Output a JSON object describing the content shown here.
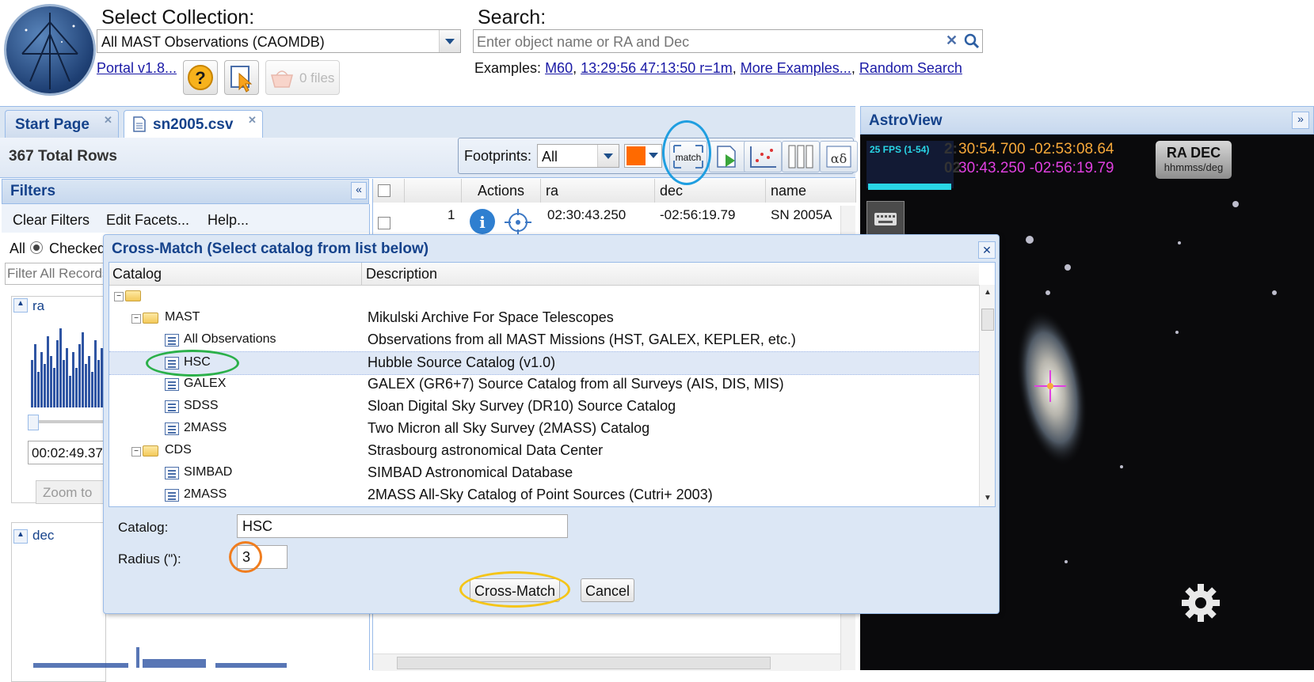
{
  "header": {
    "select_collection_label": "Select Collection:",
    "collection_value": "All MAST Observations (CAOMDB)",
    "portal_link": "Portal v1.8...",
    "files_label": "0 files",
    "search_label": "Search:",
    "search_placeholder": "Enter object name or RA and Dec",
    "examples_label": "Examples:",
    "examples": [
      "M60",
      "13:29:56 47:13:50 r=1m",
      "More Examples...",
      "Random Search"
    ]
  },
  "tabs": [
    {
      "label": "Start Page"
    },
    {
      "label": "sn2005.csv"
    }
  ],
  "toolbar": {
    "total_rows": "367 Total Rows",
    "footprints_label": "Footprints:",
    "footprints_value": "All",
    "match_label": "match",
    "footprint_color": "#ff6a00"
  },
  "filters": {
    "title": "Filters",
    "clear": "Clear Filters",
    "edit_facets": "Edit Facets...",
    "help": "Help...",
    "radio_all": "All",
    "radio_checked": "Checked",
    "filter_placeholder": "Filter All Records",
    "facet_ra": "ra",
    "ra_value": "00:02:49.37",
    "zoom_to": "Zoom to",
    "facet_dec": "dec"
  },
  "grid": {
    "columns": [
      "Actions",
      "ra",
      "dec",
      "name"
    ],
    "rows": [
      {
        "index": "1",
        "ra": "02:30:43.250",
        "dec": "-02:56:19.79",
        "name": "SN 2005A"
      }
    ]
  },
  "astroview": {
    "title": "AstroView",
    "fps": "25 FPS (1-54)",
    "coord1": "30:54.700 -02:53:08.64",
    "coord2": "30:43.250 -02:56:19.79",
    "coord_prefix1": "2:",
    "coord_prefix2": "02",
    "radec_title": "RA DEC",
    "radec_sub": "hhmmss/deg",
    "colors": {
      "coord1": "#f7a93a",
      "coord2": "#e040e0",
      "fps": "#29d6e6"
    }
  },
  "dialog": {
    "title": "Cross-Match (Select catalog from list below)",
    "col_catalog": "Catalog",
    "col_description": "Description",
    "rows": [
      {
        "name": "MAST",
        "desc": "Mikulski Archive For Space Telescopes"
      },
      {
        "name": "All Observations",
        "desc": "Observations from all MAST Missions (HST, GALEX, KEPLER, etc.)"
      },
      {
        "name": "HSC",
        "desc": "Hubble Source Catalog (v1.0)"
      },
      {
        "name": "GALEX",
        "desc": "GALEX (GR6+7) Source Catalog from all Surveys (AIS, DIS, MIS)"
      },
      {
        "name": "SDSS",
        "desc": "Sloan Digital Sky Survey (DR10) Source Catalog"
      },
      {
        "name": "2MASS",
        "desc": "Two Micron all Sky Survey (2MASS) Catalog"
      },
      {
        "name": "CDS",
        "desc": "Strasbourg astronomical Data Center"
      },
      {
        "name": "SIMBAD",
        "desc": "SIMBAD Astronomical Database"
      },
      {
        "name": "2MASS",
        "desc": "2MASS All-Sky Catalog of Point Sources (Cutri+ 2003)"
      }
    ],
    "catalog_label": "Catalog:",
    "catalog_value": "HSC",
    "radius_label": "Radius (\"):",
    "radius_value": "3",
    "crossmatch_button": "Cross-Match",
    "cancel_button": "Cancel"
  },
  "annotation_colors": {
    "blue": "#1f9ee0",
    "green": "#2bb04a",
    "orange": "#f07d1e",
    "yellow": "#f5c518"
  }
}
